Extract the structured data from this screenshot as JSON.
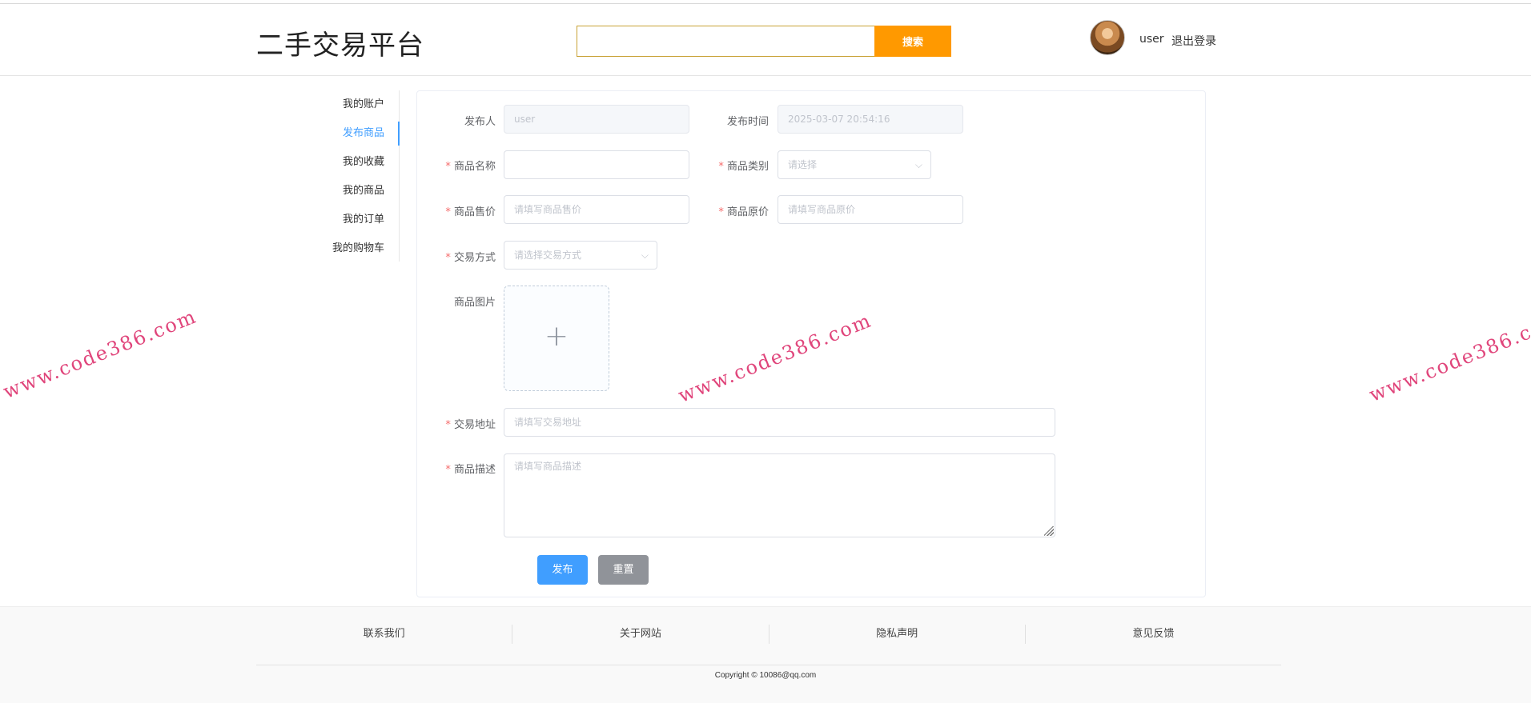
{
  "header": {
    "logo": "二手交易平台",
    "search_placeholder": "",
    "search_button": "搜索",
    "username": "user",
    "logout": "退出登录"
  },
  "sidebar": {
    "items": [
      {
        "label": "我的账户"
      },
      {
        "label": "发布商品"
      },
      {
        "label": "我的收藏"
      },
      {
        "label": "我的商品"
      },
      {
        "label": "我的订单"
      },
      {
        "label": "我的购物车"
      }
    ],
    "active_index": 1
  },
  "form": {
    "publisher": {
      "label": "发布人",
      "value": "user"
    },
    "publish_time": {
      "label": "发布时间",
      "value": "2025-03-07 20:54:16"
    },
    "product_name": {
      "label": "商品名称",
      "value": ""
    },
    "category": {
      "label": "商品类别",
      "placeholder": "请选择"
    },
    "sale_price": {
      "label": "商品售价",
      "placeholder": "请填写商品售价"
    },
    "original_price": {
      "label": "商品原价",
      "placeholder": "请填写商品原价"
    },
    "trade_method": {
      "label": "交易方式",
      "placeholder": "请选择交易方式"
    },
    "image": {
      "label": "商品图片",
      "upload_icon": "+"
    },
    "address": {
      "label": "交易地址",
      "placeholder": "请填写交易地址"
    },
    "description": {
      "label": "商品描述",
      "placeholder": "请填写商品描述"
    },
    "submit_button": "发布",
    "reset_button": "重置"
  },
  "footer": {
    "links": [
      "联系我们",
      "关于网站",
      "隐私声明",
      "意见反馈"
    ],
    "copyright": "Copyright © 10086@qq.com"
  },
  "watermark": "www.code386.com",
  "colors": {
    "accent": "#409eff",
    "search_button": "#ff9900",
    "required": "#f56c6c",
    "watermark": "#e0457b"
  }
}
